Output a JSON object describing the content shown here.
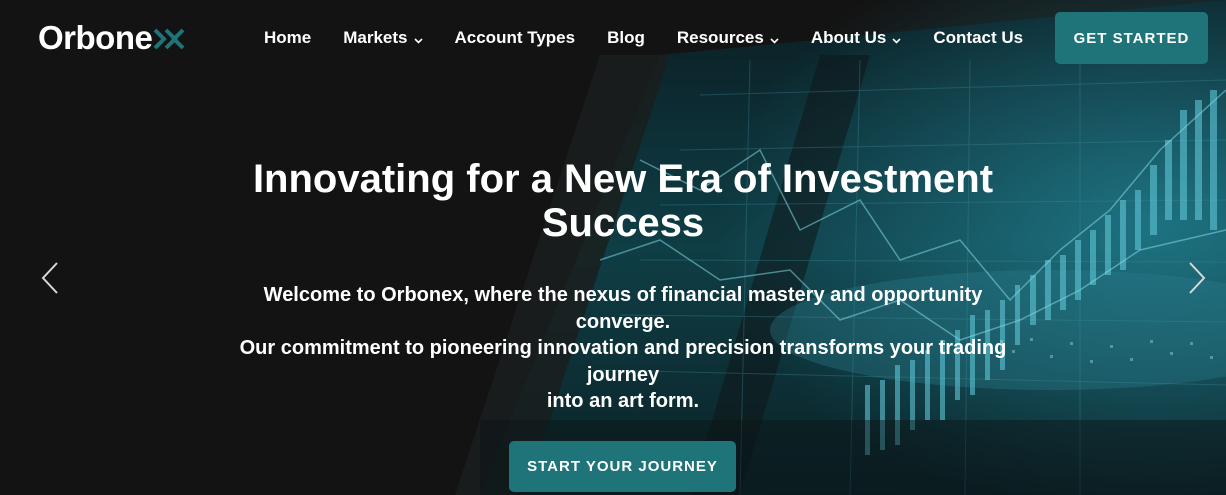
{
  "brand": {
    "name": "Orbone",
    "accent": "#1e7478"
  },
  "nav": {
    "items": [
      {
        "label": "Home",
        "has_dropdown": false
      },
      {
        "label": "Markets",
        "has_dropdown": true
      },
      {
        "label": "Account Types",
        "has_dropdown": false
      },
      {
        "label": "Blog",
        "has_dropdown": false
      },
      {
        "label": "Resources",
        "has_dropdown": true
      },
      {
        "label": "About Us",
        "has_dropdown": true
      },
      {
        "label": "Contact Us",
        "has_dropdown": false
      }
    ],
    "cta_label": "GET STARTED"
  },
  "hero": {
    "title": "Innovating for a New Era of Investment Success",
    "subtitle_lines": [
      "Welcome to Orbonex, where the nexus of financial mastery and opportunity converge.",
      "Our commitment to pioneering innovation and precision transforms your trading journey",
      "into an art form."
    ],
    "cta_label": "START YOUR JOURNEY"
  },
  "icons": {
    "logo_mark": "double-chevron-x-icon",
    "dropdown": "chevron-down-icon",
    "prev": "chevron-left-icon",
    "next": "chevron-right-icon"
  }
}
